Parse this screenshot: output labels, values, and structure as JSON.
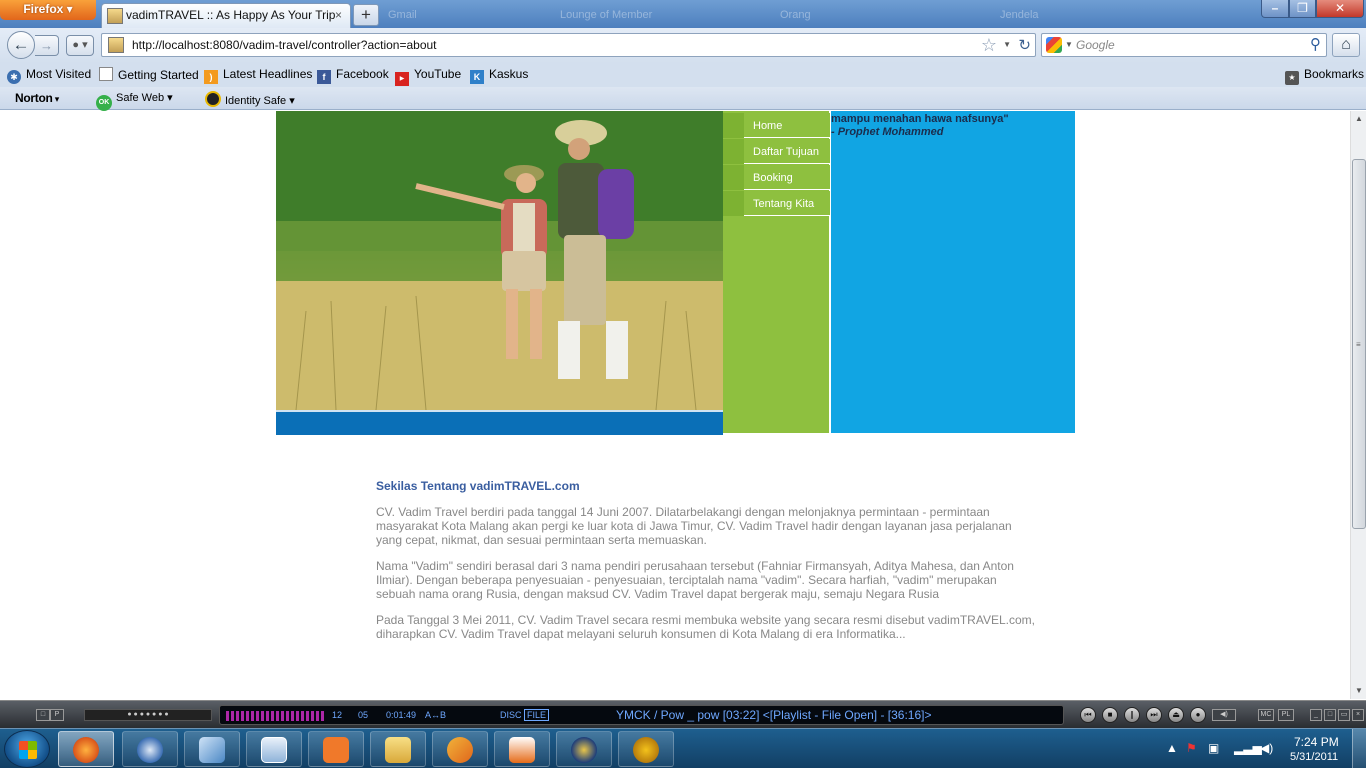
{
  "browser": {
    "app_button": "Firefox",
    "tab_title": "vadimTRAVEL :: As Happy As Your Trip",
    "tab_close": "×",
    "new_tab": "+",
    "ghost_tabs": [
      "Gmail",
      "Lounge of Member",
      "Orang",
      "Jendela"
    ],
    "window_controls": {
      "minimize": "–",
      "maximize": "❐",
      "close": "✕"
    },
    "back": "←",
    "forward": "→",
    "url": "http://localhost:8080/vadim-travel/controller?action=about",
    "search_placeholder": "Google",
    "bookmarks": [
      {
        "label": "Most Visited",
        "icon": "gear-icon",
        "color": "#3b6fb0"
      },
      {
        "label": "Getting Started",
        "icon": "page-icon",
        "color": "#ffffff"
      },
      {
        "label": "Latest Headlines",
        "icon": "rss-icon",
        "color": "#f39a1e"
      },
      {
        "label": "Facebook",
        "icon": "facebook-icon",
        "color": "#3b5998"
      },
      {
        "label": "YouTube",
        "icon": "youtube-icon",
        "color": "#d8231f"
      },
      {
        "label": "Kaskus",
        "icon": "kaskus-icon",
        "color": "#2f80c9"
      }
    ],
    "bookmarks_menu": "Bookmarks",
    "norton": {
      "logo": "Norton",
      "safe_web": "Safe Web",
      "identity_safe": "Identity Safe",
      "ok_badge": "OK"
    }
  },
  "page": {
    "nav_menu": [
      "Home",
      "Daftar Tujuan",
      "Booking",
      "Tentang Kita"
    ],
    "quote": {
      "line": "mampu menahan hawa nafsunya\"",
      "author": "- Prophet Mohammed"
    },
    "about": {
      "title": "Sekilas Tentang vadimTRAVEL.com",
      "paragraphs": [
        "CV. Vadim Travel berdiri pada tanggal 14 Juni 2007. Dilatarbelakangi dengan melonjaknya permintaan - permintaan masyarakat Kota Malang akan pergi ke luar kota di Jawa Timur, CV. Vadim Travel hadir dengan layanan jasa perjalanan yang cepat, nikmat, dan sesuai permintaan serta memuaskan.",
        "Nama \"Vadim\" sendiri berasal dari 3 nama pendiri perusahaan tersebut (Fahniar Firmansyah, Aditya Mahesa, dan Anton Ilmiar). Dengan beberapa penyesuaian - penyesuaian, terciptalah nama \"vadim\". Secara harfiah, \"vadim\" merupakan sebuah nama orang Rusia, dengan maksud CV. Vadim Travel dapat bergerak maju, semaju Negara Rusia",
        "Pada Tanggal 3 Mei 2011, CV. Vadim Travel secara resmi membuka website yang secara resmi disebut vadimTRAVEL.com, diharapkan CV. Vadim Travel dapat melayani seluruh konsumen di Kota Malang di era Informatika..."
      ]
    },
    "colors": {
      "green": "#8ec03f",
      "blue_panel": "#11a5e3",
      "photo_bar": "#0a6fb7",
      "title": "#3a5ea0"
    }
  },
  "media_player": {
    "counter_a": "12",
    "counter_b": "05",
    "time": "0:01:49",
    "mode": "A↔B",
    "disc": "DISC",
    "file": "FILE",
    "track": "YMCK / Pow _ pow  [03:22]    <[Playlist - File Open] - [36:16]>"
  },
  "taskbar": {
    "time": "7:24 PM",
    "date": "5/31/2011",
    "apps": [
      "firefox-icon",
      "thunderbird-icon",
      "virtualbox-icon",
      "explorer-icon",
      "xampp-icon",
      "folder-icon",
      "netbeans-icon",
      "media-player-icon",
      "browser-icon",
      "globe-icon"
    ]
  }
}
